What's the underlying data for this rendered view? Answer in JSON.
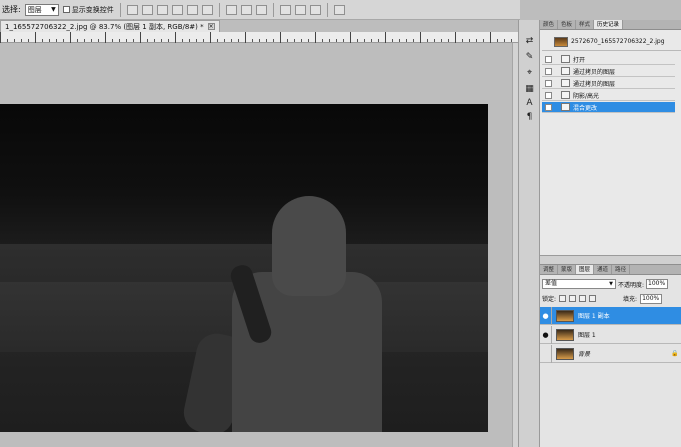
{
  "options_bar": {
    "select_label": "选择:",
    "layer_select_value": "图层",
    "show_transform_label": "显示变换控件"
  },
  "document": {
    "tab_title": "1_165572706322_2.jpg @ 83.7% (图层 1 副本, RGB/8#) *",
    "close_glyph": "×"
  },
  "dock": {
    "icons": [
      "adjust-icon",
      "brush-icon",
      "stamp-icon",
      "swatch-icon",
      "text-icon",
      "paragraph-icon"
    ],
    "glyphs": [
      "⇄",
      "✎",
      "⌖",
      "▦",
      "A",
      "¶"
    ]
  },
  "history_panel": {
    "tabs": [
      "颜色",
      "色板",
      "样式",
      "历史记录"
    ],
    "active_tab": 3,
    "snapshot_label": "2572670_165572706322_2.jpg",
    "items": [
      {
        "label": "打开",
        "selected": false
      },
      {
        "label": "通过拷贝的图层",
        "selected": false
      },
      {
        "label": "通过拷贝的图层",
        "selected": false
      },
      {
        "label": "阴影/高光",
        "selected": false
      },
      {
        "label": "混合更改",
        "selected": true
      }
    ]
  },
  "layers_panel": {
    "tabs": [
      "调整",
      "蒙版",
      "图层",
      "通道",
      "路径"
    ],
    "active_tab": 2,
    "blend_mode": "差值",
    "opacity_label": "不透明度:",
    "opacity_value": "100%",
    "lock_label": "锁定:",
    "fill_label": "填充:",
    "fill_value": "100%",
    "layers": [
      {
        "name": "图层 1 副本",
        "visible": true,
        "selected": true,
        "locked": false
      },
      {
        "name": "图层 1",
        "visible": true,
        "selected": false,
        "locked": false
      },
      {
        "name": "背景",
        "visible": false,
        "selected": false,
        "locked": true
      }
    ],
    "eye_glyph": "●",
    "lock_glyph": "🔒"
  }
}
